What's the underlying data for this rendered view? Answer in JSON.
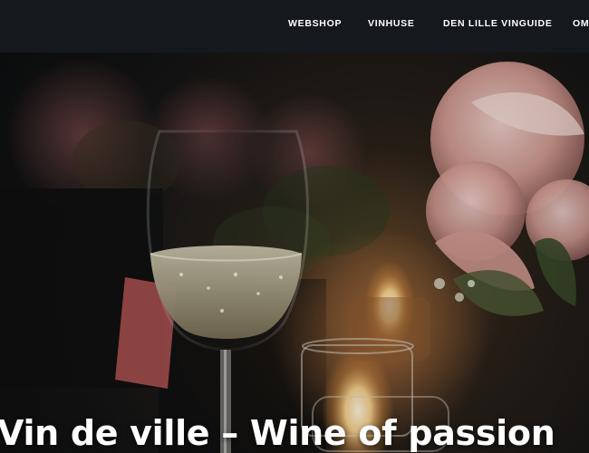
{
  "nav": {
    "items": [
      {
        "label": "WEBSHOP"
      },
      {
        "label": "VINHUSE"
      },
      {
        "label": "DEN LILLE VINGUIDE"
      },
      {
        "label": "OM"
      }
    ]
  },
  "hero": {
    "title": "Vin de ville – Wine of passion",
    "image": "wine-glass-candlelight-photo"
  },
  "colors": {
    "topbar": "#15181c",
    "nav_text": "#ffffff",
    "title_text": "#ffffff"
  }
}
